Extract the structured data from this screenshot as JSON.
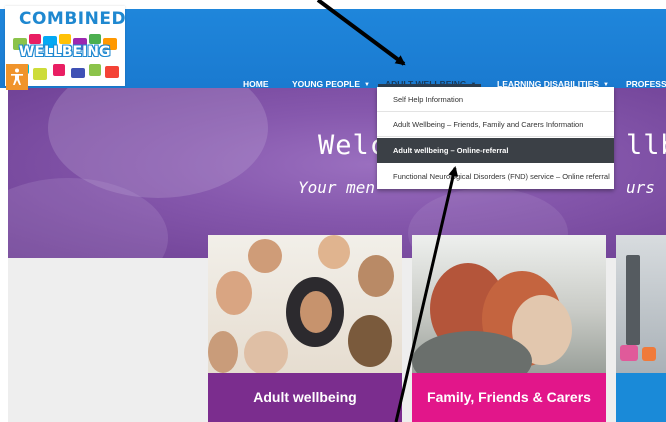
{
  "logo": {
    "line1": "COMBINED",
    "line2": "WELLBEING"
  },
  "nav": {
    "items": [
      {
        "label": "HOME",
        "has_caret": false
      },
      {
        "label": "YOUNG PEOPLE",
        "has_caret": true
      },
      {
        "label": "ADULT WELLBEING",
        "has_caret": true,
        "active": true
      },
      {
        "label": "LEARNING DISABILITIES",
        "has_caret": true
      },
      {
        "label": "PROFESSI",
        "has_caret": false
      }
    ],
    "caret": "▼"
  },
  "dropdown": {
    "items": [
      "Self Help Information",
      "Adult Wellbeing – Friends, Family and Carers Information",
      "Adult wellbeing – Online-referral",
      "Functional Neurological Disorders (FND) service – Online referral"
    ],
    "highlighted_index": 2
  },
  "hero": {
    "title_left": "Welc",
    "title_right": "llbe",
    "subtitle_left": "Your men",
    "subtitle_right": "urs f"
  },
  "cards": [
    {
      "label": "Adult wellbeing",
      "color": "#7b2d8e"
    },
    {
      "label": "Family, Friends & Carers",
      "color": "#e2168a"
    },
    {
      "label": "",
      "color": "#1a8ad8"
    }
  ],
  "colors": {
    "navbar": "#1f86db",
    "hero": "#8658ad",
    "dropdown_highlight": "#3b4046",
    "accessibility": "#f0942b"
  },
  "icons": {
    "accessibility": "accessibility-icon",
    "caret": "caret-down-icon"
  }
}
